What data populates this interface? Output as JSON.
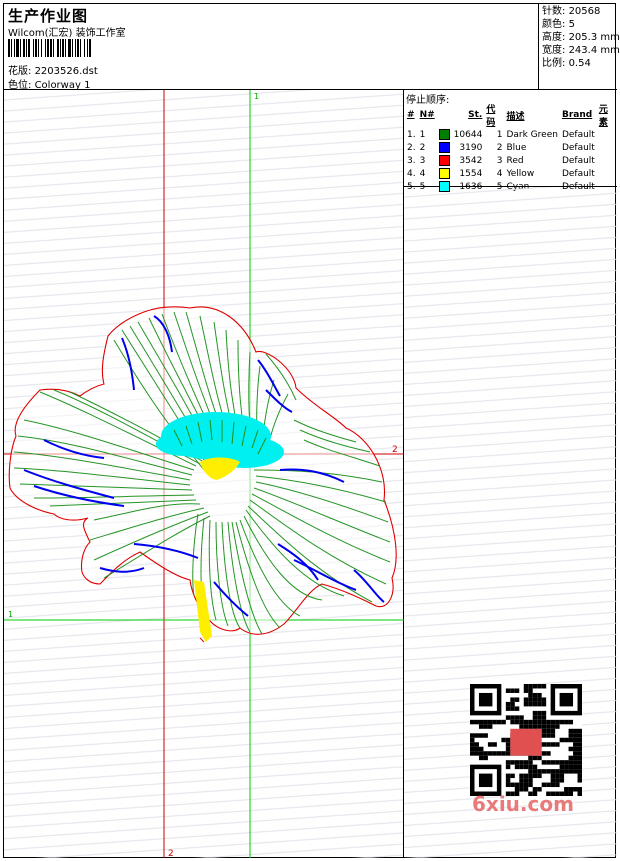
{
  "header": {
    "title": "生产作业图",
    "subtitle": "Wilcom(汇宏) 装饰工作室",
    "design_label": "花版:",
    "design_value": "2203526.dst",
    "colorway_label": "色位:",
    "colorway_value": "Colorway 1"
  },
  "stats": [
    {
      "label": "针数:",
      "value": "20568"
    },
    {
      "label": "颜色:",
      "value": "5"
    },
    {
      "label": "高度:",
      "value": "205.3 mm"
    },
    {
      "label": "宽度:",
      "value": "243.4 mm"
    },
    {
      "label": "比例:",
      "value": "0.54"
    }
  ],
  "legend": {
    "title": "停止顺序:",
    "headers": [
      "#",
      "N#",
      "St.",
      "代码",
      "描述",
      "Brand",
      "元素"
    ],
    "rows": [
      {
        "index": "1.",
        "n": "1",
        "color": "#008000",
        "stitches": "10644",
        "code": "1",
        "desc": "Dark Green",
        "brand": "Default"
      },
      {
        "index": "2.",
        "n": "2",
        "color": "#0000ff",
        "stitches": "3190",
        "code": "2",
        "desc": "Blue",
        "brand": "Default"
      },
      {
        "index": "3.",
        "n": "3",
        "color": "#ff0000",
        "stitches": "3542",
        "code": "3",
        "desc": "Red",
        "brand": "Default"
      },
      {
        "index": "4.",
        "n": "4",
        "color": "#ffff00",
        "stitches": "1554",
        "code": "4",
        "desc": "Yellow",
        "brand": "Default"
      },
      {
        "index": "5.",
        "n": "5",
        "color": "#00ffff",
        "stitches": "1636",
        "code": "5",
        "desc": "Cyan",
        "brand": "Default"
      }
    ]
  },
  "canvas": {
    "guide_labels": {
      "top": "1",
      "right": "2",
      "left": "1",
      "bottom": "2"
    },
    "guide_colors": {
      "vertical_red": "#cc0000",
      "vertical_green": "#00cc00",
      "horizontal_red": "#cc0000",
      "horizontal_green": "#00cc00"
    }
  },
  "watermark": "6xiu.com"
}
